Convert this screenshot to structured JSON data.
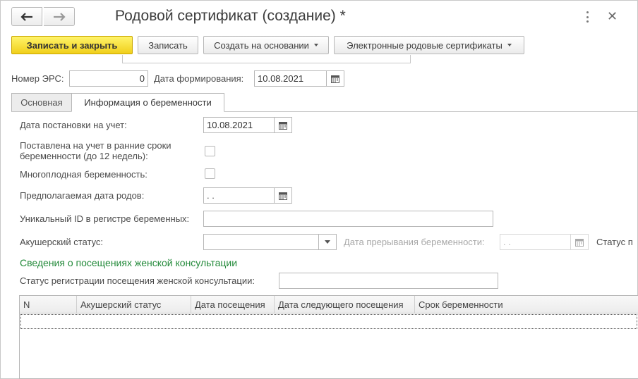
{
  "window": {
    "title": "Родовой сертификат (создание) *"
  },
  "toolbar": {
    "save_close": "Записать и закрыть",
    "save": "Записать",
    "create_based": "Создать на основании",
    "electronic_certs": "Электронные родовые сертификаты"
  },
  "header_fields": {
    "ers_label": "Номер ЭРС:",
    "ers_value": "0",
    "formation_date_label": "Дата формирования:",
    "formation_date_value": "10.08.2021"
  },
  "tabs": [
    {
      "label": "Основная",
      "active": false
    },
    {
      "label": "Информация о беременности",
      "active": true
    }
  ],
  "form": {
    "registration_date_label": "Дата постановки на учет:",
    "registration_date_value": "10.08.2021",
    "early_registration_label": "Поставлена на учет в ранние сроки беременности (до 12 недель):",
    "early_registration_checked": false,
    "multiple_pregnancy_label": "Многоплодная беременность:",
    "multiple_pregnancy_checked": false,
    "expected_birth_label": "Предполагаемая дата родов:",
    "expected_birth_value": " .  .",
    "unique_id_label": "Уникальный ID в регистре беременных:",
    "unique_id_value": "",
    "obstetric_status_label": "Акушерский статус:",
    "obstetric_status_value": "",
    "termination_date_label": "Дата прерывания беременности:",
    "termination_date_value": " .  .",
    "status_cut_label": "Статус п"
  },
  "consultation_section": {
    "title": "Сведения о посещениях женской консультации",
    "reg_status_label": "Статус регистрации посещения женской консультации:",
    "reg_status_value": ""
  },
  "visits_table": {
    "columns": [
      "N",
      "Акушерский статус",
      "Дата посещения",
      "Дата следующего посещения",
      "Срок беременности"
    ],
    "rows": []
  },
  "icons": {
    "back": "arrow-left-icon",
    "forward": "arrow-right-icon",
    "more": "more-vertical-icon",
    "close": "close-icon",
    "calendar": "calendar-icon",
    "dropdown": "chevron-down-icon"
  },
  "colors": {
    "primary_button": "#f5d92b",
    "section_title": "#238a3a"
  }
}
